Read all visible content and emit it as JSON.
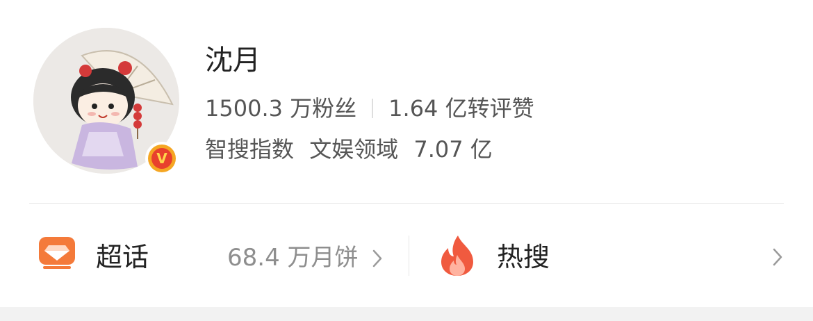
{
  "profile": {
    "name": "沈月",
    "followers": "1500.3 万粉丝",
    "likes": "1.64 亿转评赞",
    "index_label": "智搜指数",
    "domain": "文娱领域",
    "index_value": "7.07 亿",
    "verified_badge": "V"
  },
  "bar": {
    "supertopic": {
      "label": "超话",
      "count": "68.4 万月饼",
      "icon": "diamond-badge-icon"
    },
    "hotsearch": {
      "label": "热搜",
      "icon": "flame-icon"
    }
  },
  "colors": {
    "text_primary": "#222222",
    "text_secondary": "#555555",
    "text_muted": "#8e8e8e",
    "supertopic_orange": "#f47a3a",
    "flame_red": "#f05a3f",
    "verified_gold": "#f5a623",
    "verified_red": "#e8402d"
  }
}
